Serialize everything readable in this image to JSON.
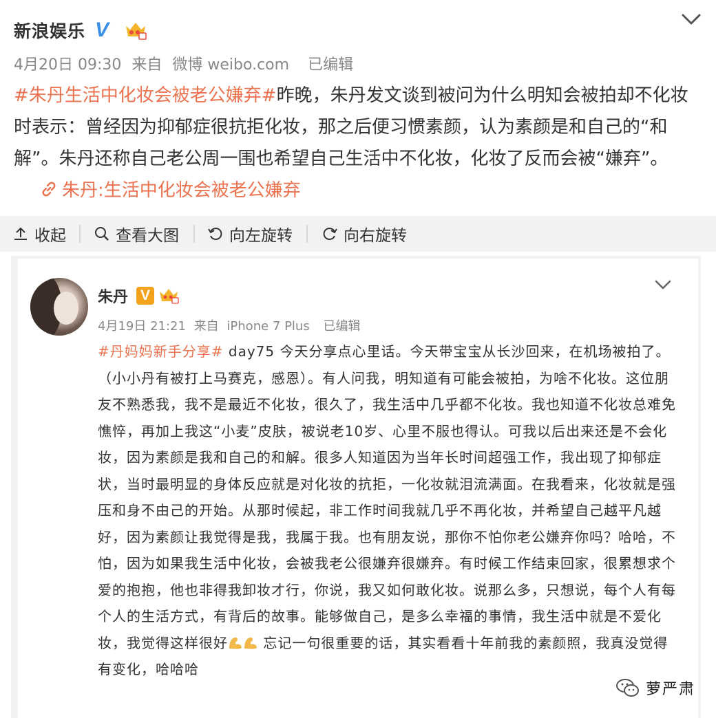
{
  "post": {
    "author": "新浪娱乐",
    "verified_icon": "verified-v-icon",
    "crown_icon": "vip-crown-icon",
    "meta": {
      "date": "4月20日 09:30",
      "source_prefix": "来自",
      "source": "微博 weibo.com",
      "edited": "已编辑"
    },
    "hashtag": "#朱丹生活中化妆会被老公嫌弃#",
    "body": "昨晚，朱丹发文谈到被问为什么明知会被拍却不化妆时表示：曾经因为抑郁症很抗拒化妆，那之后便习惯素颜，认为素颜是和自己的“和解”。朱丹还称自己老公周一围也希望自己生活中不化妆，化妆了反而会被“嫌弃”。",
    "link_text": "朱丹:生活中化妆会被老公嫌弃",
    "accent_color": "#eb7350"
  },
  "toolbar": {
    "collapse": "收起",
    "view_large": "查看大图",
    "rotate_left": "向左旋转",
    "rotate_right": "向右旋转"
  },
  "embedded": {
    "author": "朱丹",
    "meta": {
      "date": "4月19日 21:21",
      "source_prefix": "来自",
      "source": "iPhone 7 Plus",
      "edited": "已编辑"
    },
    "hashtag": "#丹妈妈新手分享#",
    "body_before_emoji": " day75 今天分享点心里话。今天带宝宝从长沙回来，在机场被拍了。（小小丹有被打上马赛克，感恩）。有人问我，明知道有可能会被拍，为啥不化妆。这位朋友不熟悉我，我不是最近不化妆，很久了，我生活中几乎都不化妆。我也知道不化妆总难免憔悴，再加上我这“小麦”皮肤，被说老10岁、心里不服也得认。可我以后出来还是不会化妆，因为素颜是我和自己的和解。很多人知道因为当年长时间超强工作，我出现了抑郁症状，当时最明显的身体反应就是对化妆的抗拒，一化妆就泪流满面。在我看来，化妆就是强压和身不由己的开始。从那时候起，非工作时间我就几乎不再化妆，并希望自己越平凡越好，因为素颜让我觉得是我，我属于我。也有朋友说，那你不怕你老公嫌弃你吗？哈哈，不怕，因为如果我生活中化妆，会被我老公很嫌弃很嫌弃。有时候工作结束回家，很累想求个爱的抱抱，他也非得我卸妆才行，你说，我又如何敢化妆。说那么多，只想说，每个人有每个人的生活方式，有背后的故事。能够做自己，是多么幸福的事情，我生活中就是不爱化妆，我觉得这样很好",
    "emoji": "muscle-emoji-icon",
    "body_after_emoji": " 忘记一句很重要的话，其实看看十年前我的素颜照，我真没觉得有变化，哈哈哈"
  },
  "watermark": {
    "icon": "wechat-official-icon",
    "text": "萝严肃"
  }
}
